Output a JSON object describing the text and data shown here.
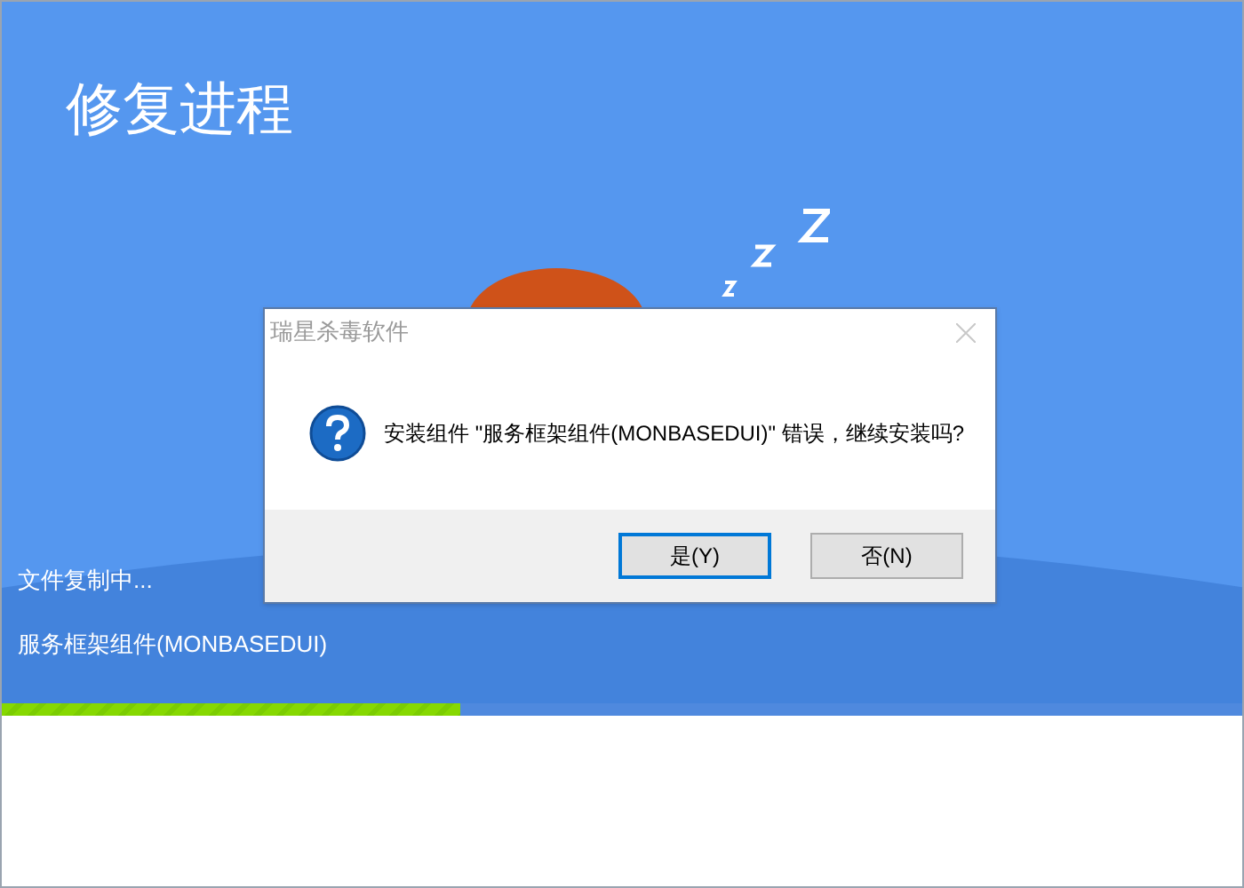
{
  "window": {
    "title": "修复进程"
  },
  "status": {
    "action": "文件复制中...",
    "component": "服务框架组件(MONBASEDUI)"
  },
  "progress": {
    "level": 0.37
  },
  "dialog": {
    "title": "瑞星杀毒软件",
    "message": "安装组件 \"服务框架组件(MONBASEDUI)\" 错误，继续安装吗?",
    "buttons": [
      {
        "label": "是(Y)",
        "selected": true
      },
      {
        "label": "否(N)",
        "selected": false
      }
    ]
  }
}
